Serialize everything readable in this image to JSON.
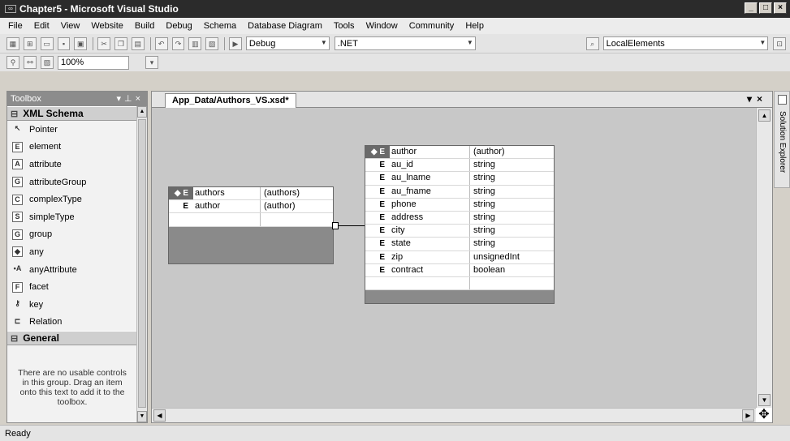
{
  "window": {
    "title": "Chapter5 - Microsoft Visual Studio"
  },
  "menu": [
    "File",
    "Edit",
    "View",
    "Website",
    "Build",
    "Debug",
    "Schema",
    "Database Diagram",
    "Tools",
    "Window",
    "Community",
    "Help"
  ],
  "toolbar": {
    "config_combo": "Debug",
    "platform_combo": ".NET",
    "search_combo": "LocalElements",
    "zoom": "100%"
  },
  "toolbox": {
    "title": "Toolbox",
    "xml_group": "XML Schema",
    "items": [
      {
        "icon": "pointer-icon",
        "glyph": "↖",
        "label": "Pointer"
      },
      {
        "icon": "element-icon",
        "glyph": "E",
        "label": "element"
      },
      {
        "icon": "attribute-icon",
        "glyph": "A",
        "label": "attribute"
      },
      {
        "icon": "attribute-group-icon",
        "glyph": "AG",
        "label": "attributeGroup"
      },
      {
        "icon": "complex-type-icon",
        "glyph": "CT",
        "label": "complexType"
      },
      {
        "icon": "simple-type-icon",
        "glyph": "ST",
        "label": "simpleType"
      },
      {
        "icon": "group-icon",
        "glyph": "G",
        "label": "group"
      },
      {
        "icon": "any-icon",
        "glyph": "◆",
        "label": "any"
      },
      {
        "icon": "any-attribute-icon",
        "glyph": "•A",
        "label": "anyAttribute"
      },
      {
        "icon": "facet-icon",
        "glyph": "F",
        "label": "facet"
      },
      {
        "icon": "key-icon",
        "glyph": "⚷",
        "label": "key"
      },
      {
        "icon": "relation-icon",
        "glyph": "⊏",
        "label": "Relation"
      }
    ],
    "general_group": "General",
    "empty_text": "There are no usable controls in this group. Drag an item onto this text to add it to the toolbox."
  },
  "document": {
    "tab": "App_Data/Authors_VS.xsd*",
    "authors_element": {
      "header": {
        "icon": "E",
        "name": "authors",
        "type": "(authors)"
      },
      "rows": [
        {
          "icon": "E",
          "name": "author",
          "type": "(author)"
        }
      ]
    },
    "author_element": {
      "header": {
        "icon": "E",
        "name": "author",
        "type": "(author)"
      },
      "rows": [
        {
          "icon": "E",
          "name": "au_id",
          "type": "string"
        },
        {
          "icon": "E",
          "name": "au_lname",
          "type": "string"
        },
        {
          "icon": "E",
          "name": "au_fname",
          "type": "string"
        },
        {
          "icon": "E",
          "name": "phone",
          "type": "string"
        },
        {
          "icon": "E",
          "name": "address",
          "type": "string"
        },
        {
          "icon": "E",
          "name": "city",
          "type": "string"
        },
        {
          "icon": "E",
          "name": "state",
          "type": "string"
        },
        {
          "icon": "E",
          "name": "zip",
          "type": "unsignedInt"
        },
        {
          "icon": "E",
          "name": "contract",
          "type": "boolean"
        }
      ]
    }
  },
  "solution_explorer": "Solution Explorer",
  "status": "Ready"
}
